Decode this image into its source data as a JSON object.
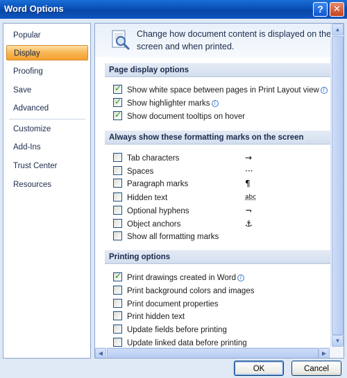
{
  "window": {
    "title": "Word Options",
    "help_glyph": "?",
    "close_glyph": "✕"
  },
  "sidebar": {
    "items": [
      {
        "label": "Popular"
      },
      {
        "label": "Display",
        "active": true
      },
      {
        "label": "Proofing"
      },
      {
        "label": "Save"
      },
      {
        "label": "Advanced"
      },
      {
        "label": "Customize"
      },
      {
        "label": "Add-Ins"
      },
      {
        "label": "Trust Center"
      },
      {
        "label": "Resources"
      }
    ]
  },
  "header": {
    "text": "Change how document content is displayed on the screen and when printed.",
    "icon": "magnifier-document-icon"
  },
  "sections": {
    "page_display": {
      "title": "Page display options",
      "options": [
        {
          "label": "Show white space between pages in Print Layout view",
          "checked": true,
          "info": true
        },
        {
          "label": "Show highlighter marks",
          "checked": true,
          "info": true
        },
        {
          "label": "Show document tooltips on hover",
          "checked": true,
          "info": false
        }
      ]
    },
    "formatting_marks": {
      "title": "Always show these formatting marks on the screen",
      "options": [
        {
          "label": "Tab characters",
          "checked": false,
          "mark": "→"
        },
        {
          "label": "Spaces",
          "checked": false,
          "mark": "···"
        },
        {
          "label": "Paragraph marks",
          "checked": false,
          "mark": "¶"
        },
        {
          "label": "Hidden text",
          "checked": false,
          "mark": "abc"
        },
        {
          "label": "Optional hyphens",
          "checked": false,
          "mark": "¬"
        },
        {
          "label": "Object anchors",
          "checked": false,
          "mark": "⚓"
        },
        {
          "label": "Show all formatting marks",
          "checked": false,
          "mark": ""
        }
      ]
    },
    "printing": {
      "title": "Printing options",
      "options": [
        {
          "label": "Print drawings created in Word",
          "checked": true,
          "info": true
        },
        {
          "label": "Print background colors and images",
          "checked": false
        },
        {
          "label": "Print document properties",
          "checked": false
        },
        {
          "label": "Print hidden text",
          "checked": false
        },
        {
          "label": "Update fields before printing",
          "checked": false
        },
        {
          "label": "Update linked data before printing",
          "checked": false
        }
      ]
    }
  },
  "buttons": {
    "ok": "OK",
    "cancel": "Cancel"
  },
  "colors": {
    "titlebar": "#0a4fb8",
    "active_item": "#f8b552",
    "section_band": "#d3deee",
    "check": "#21a121"
  }
}
